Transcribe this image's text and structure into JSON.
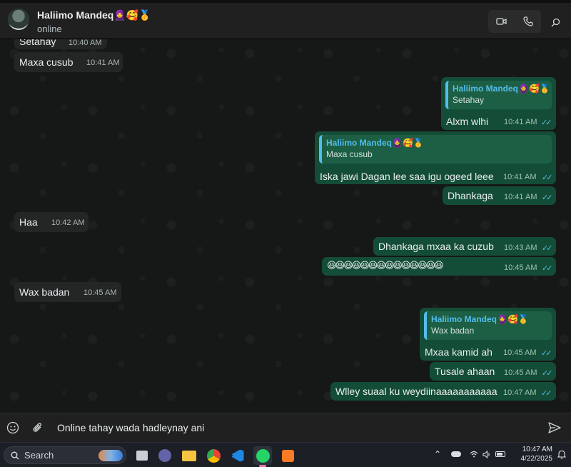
{
  "header": {
    "contact_name": "Haliimo Mandeq🧕🥰🥇",
    "status": "online"
  },
  "messages": [
    {
      "dir": "in",
      "text": "Setahay",
      "time": "10:40 AM"
    },
    {
      "dir": "in",
      "text": "Maxa cusub",
      "time": "10:41 AM"
    },
    {
      "dir": "out",
      "quote_name": "Haliimo Mandeq🧕🥰🥇",
      "quote_text": "Setahay",
      "text": "Alxm wlhi",
      "time": "10:41 AM"
    },
    {
      "dir": "out",
      "quote_name": "Haliimo Mandeq🧕🥰🥇",
      "quote_text": "Maxa cusub",
      "text": "Iska jawi Dagan lee saa  igu ogeed leee",
      "time": "10:41 AM"
    },
    {
      "dir": "out",
      "text": "Dhankaga",
      "time": "10:41 AM"
    },
    {
      "dir": "in",
      "text": "Haa",
      "time": "10:42 AM"
    },
    {
      "dir": "out",
      "text": "Dhankaga mxaa ka cuzub",
      "time": "10:43 AM"
    },
    {
      "dir": "out",
      "text": "😆😆😆😆😆😆😆😆😆😆😆😆😆😆",
      "time": "10:45 AM"
    },
    {
      "dir": "in",
      "text": "Wax badan",
      "time": "10:45 AM"
    },
    {
      "dir": "out",
      "quote_name": "Haliimo Mandeq🧕🥰🥇",
      "quote_text": "Wax badan",
      "text": "Mxaa kamid ah",
      "time": "10:45 AM"
    },
    {
      "dir": "out",
      "text": "Tusale ahaan",
      "time": "10:45 AM"
    },
    {
      "dir": "out",
      "text": "Wlley suaal ku weydiinaaaaaaaaaaa",
      "time": "10:47 AM"
    }
  ],
  "composer": {
    "draft": "Online tahay wada hadleynay ani"
  },
  "taskbar": {
    "search_label": "Search",
    "time": "10:47 AM",
    "date": "4/22/2025"
  },
  "colors": {
    "incoming_bubble": "#242626",
    "outgoing_bubble": "#144d37",
    "read_ticks": "#53bdeb"
  }
}
